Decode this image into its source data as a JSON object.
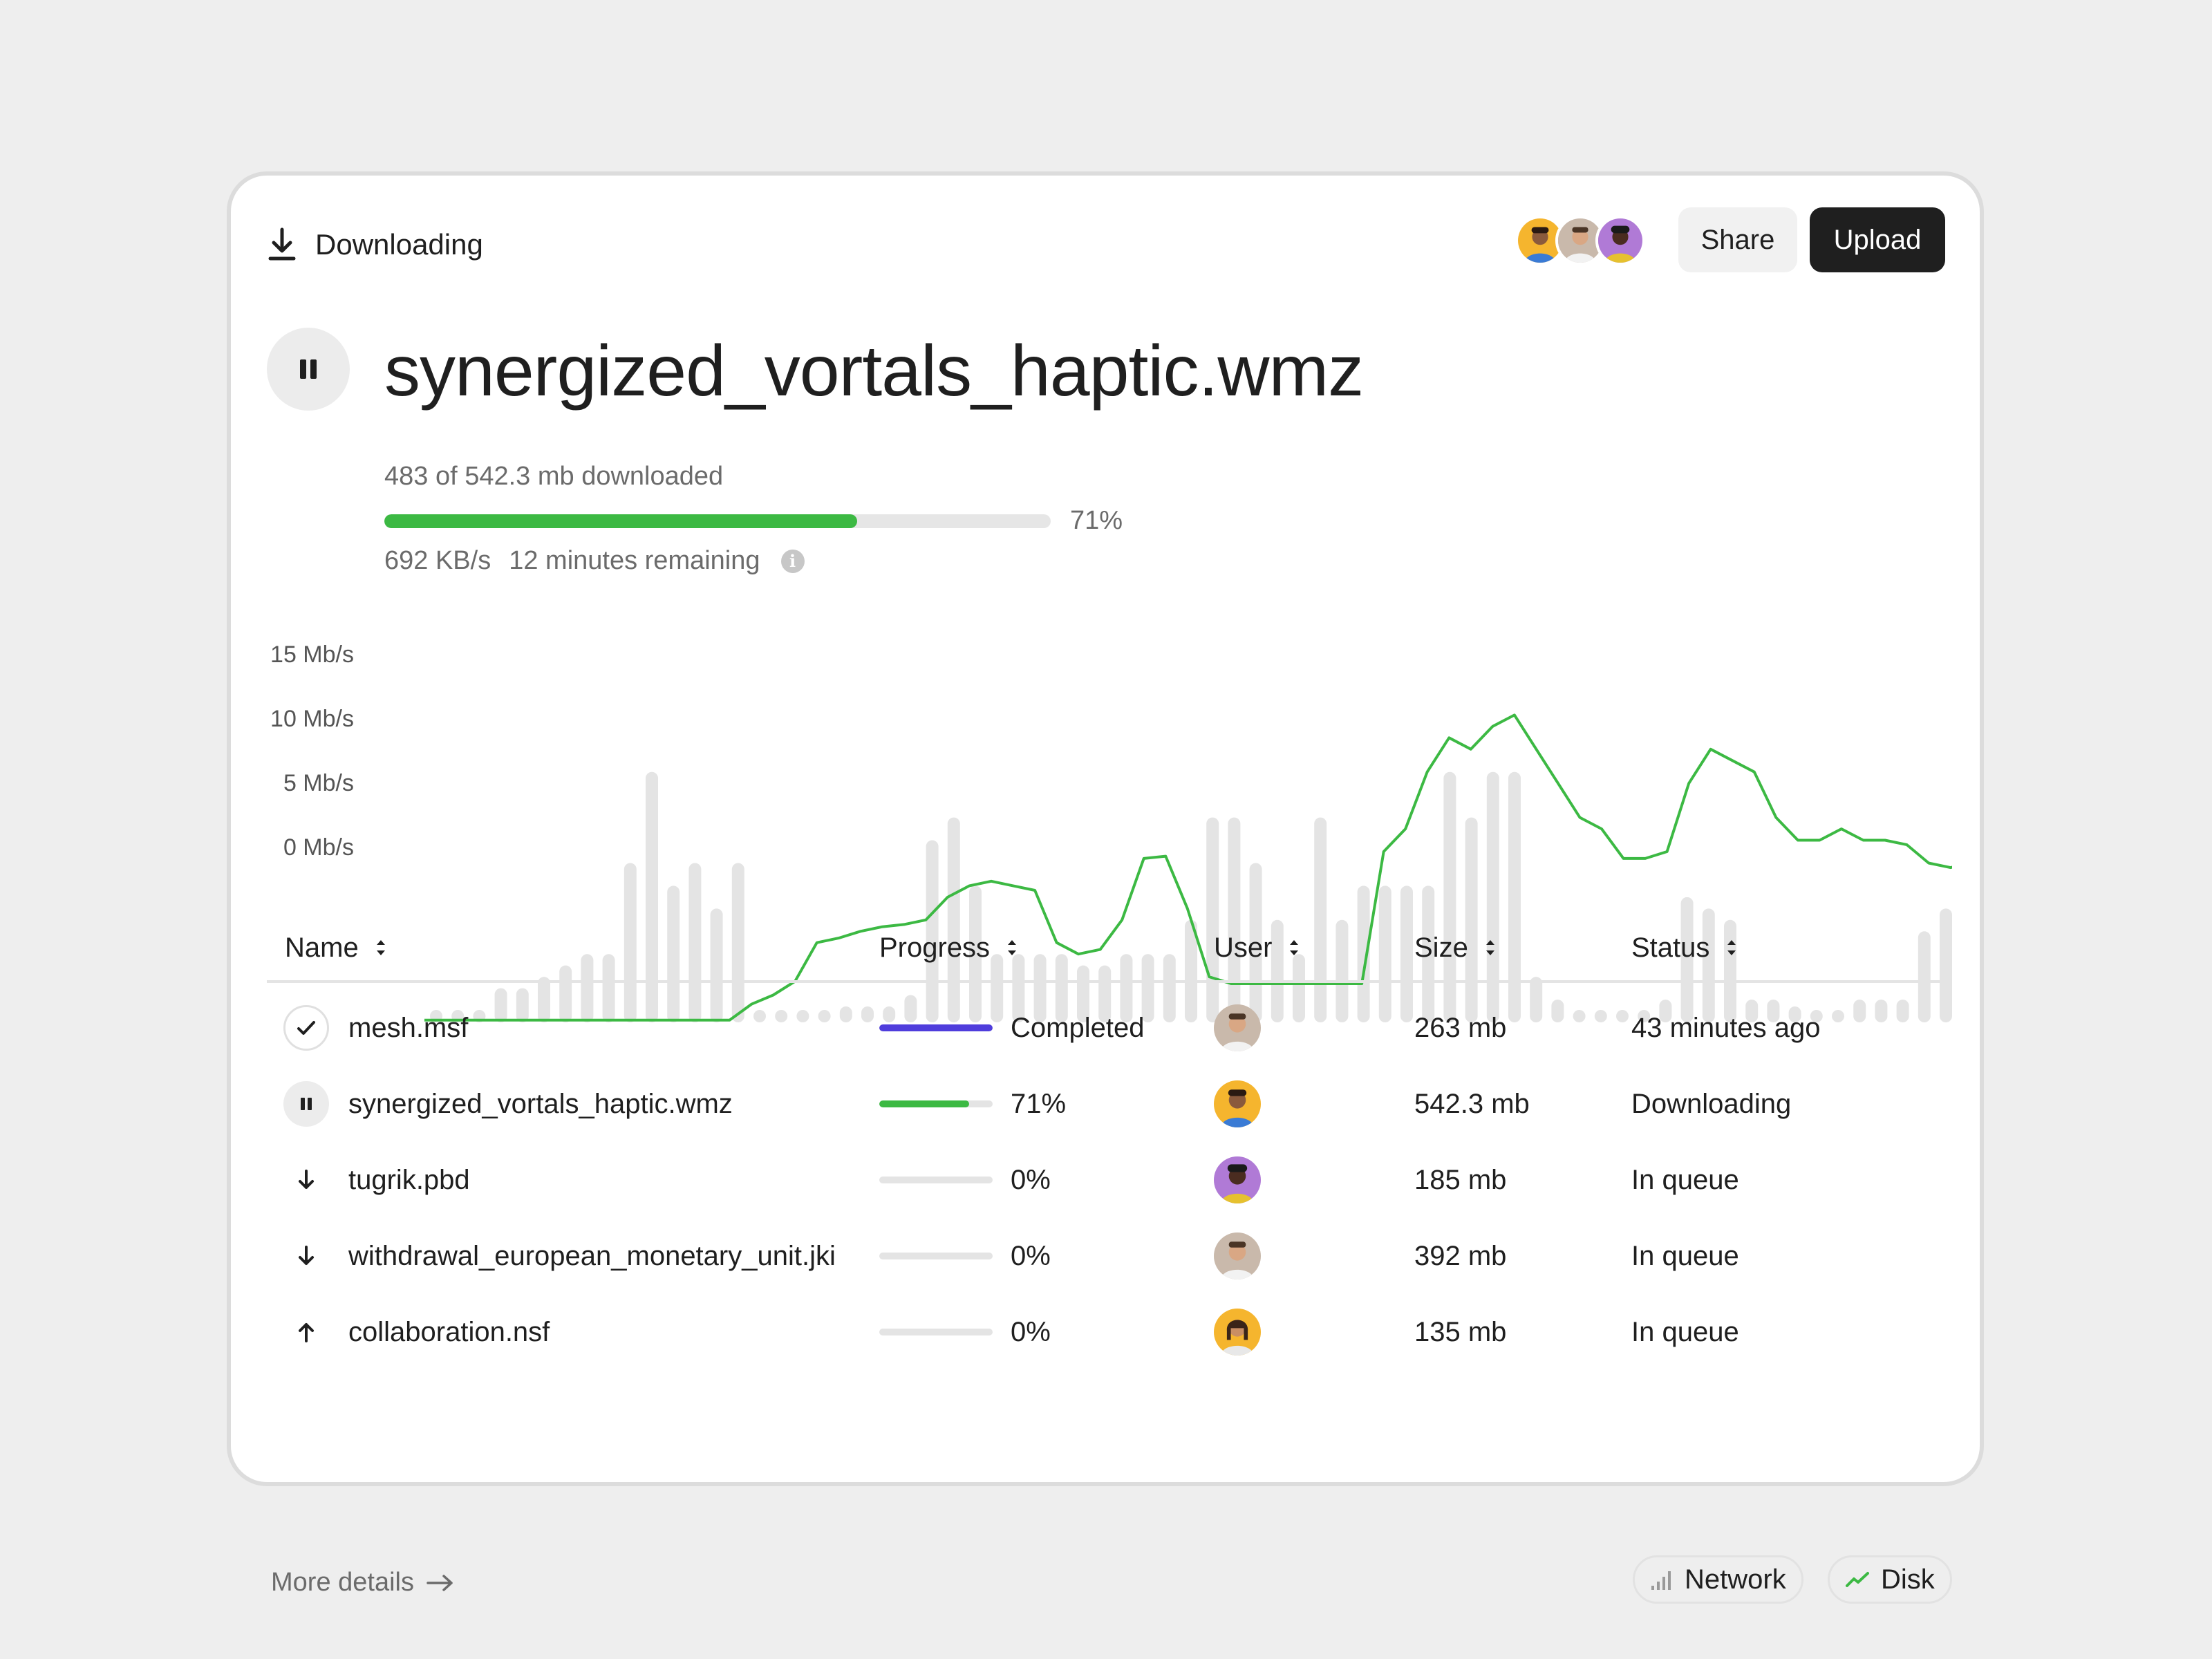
{
  "header": {
    "title": "Downloading",
    "share_label": "Share",
    "upload_label": "Upload"
  },
  "file": {
    "name": "synergized_vortals_haptic.wmz",
    "downloaded_text": "483 of 542.3 mb downloaded",
    "progress_percent": "71%",
    "progress_fraction": 0.71,
    "speed": "692 KB/s",
    "remaining": "12 minutes remaining"
  },
  "chart_data": {
    "type": "bar",
    "y_tick_labels": [
      "15 Mb/s",
      "10 Mb/s",
      "5 Mb/s",
      "0 Mb/s"
    ],
    "ylim": [
      0,
      15
    ],
    "bar_color": "#e4e4e4",
    "line_color": "#3cb943",
    "series": [
      {
        "kind": "bar",
        "values": [
          0.1,
          0.1,
          0.1,
          1.5,
          1.5,
          2.0,
          2.5,
          3.0,
          3.0,
          7.0,
          11.0,
          6.0,
          7.0,
          5.0,
          7.0,
          0.5,
          0.5,
          0.3,
          0.3,
          0.7,
          0.7,
          0.7,
          1.2,
          8.0,
          9.0,
          6.0,
          3.0,
          3.0,
          3.0,
          3.0,
          2.5,
          2.5,
          3.0,
          3.0,
          3.0,
          4.5,
          9.0,
          9.0,
          7.0,
          4.5,
          3.0,
          9.0,
          4.5,
          6.0,
          6.0,
          6.0,
          6.0,
          11.0,
          9.0,
          11.0,
          11.0,
          2.0,
          1.0,
          0.1,
          0.1,
          0.5,
          0.5,
          1.0,
          5.5,
          5.0,
          4.5,
          1.0,
          1.0,
          0.7,
          0.3,
          0.3,
          1.0,
          1.0,
          1.0,
          4.0,
          5.0,
          5.5,
          6.0,
          7.0,
          6.5,
          11.0,
          4.5,
          1.2
        ]
      },
      {
        "kind": "line",
        "values": [
          0.1,
          0.1,
          0.1,
          0.1,
          0.1,
          0.1,
          0.1,
          0.1,
          0.1,
          0.1,
          0.1,
          0.1,
          0.1,
          0.1,
          0.1,
          0.8,
          1.2,
          1.8,
          3.5,
          3.7,
          4.0,
          4.2,
          4.3,
          4.5,
          5.5,
          6.0,
          6.2,
          6.0,
          5.8,
          3.5,
          3.0,
          3.2,
          4.5,
          7.2,
          7.3,
          5.0,
          2.0,
          1.7,
          1.7,
          1.7,
          1.7,
          1.7,
          1.7,
          1.7,
          7.5,
          8.5,
          11.0,
          12.5,
          12.0,
          13.0,
          13.5,
          12.0,
          10.5,
          9.0,
          8.5,
          7.2,
          7.2,
          7.5,
          10.5,
          12.0,
          11.5,
          11.0,
          9.0,
          8.0,
          8.0,
          8.5,
          8.0,
          8.0,
          7.8,
          7.0,
          6.8,
          7.0,
          7.2,
          8.0,
          9.5,
          10.5,
          12.0,
          12.0
        ]
      }
    ]
  },
  "table": {
    "columns": [
      "Name",
      "Progress",
      "User",
      "Size",
      "Status"
    ],
    "rows": [
      {
        "icon": "check-icon",
        "name": "mesh.msf",
        "progress_label": "Completed",
        "progress": 1.0,
        "bar_color": "#4f3ddc",
        "user_avatar": "avatar-man-beard",
        "size": "263 mb",
        "status": "43 minutes ago"
      },
      {
        "icon": "pause-icon",
        "name": "synergized_vortals_haptic.wmz",
        "progress_label": "71%",
        "progress": 0.79,
        "bar_color": "#3cb943",
        "user_avatar": "avatar-man-yellow",
        "size": "542.3 mb",
        "status": "Downloading"
      },
      {
        "icon": "arrow-down-icon",
        "name": "tugrik.pbd",
        "progress_label": "0%",
        "progress": 0.0,
        "bar_color": "#3cb943",
        "user_avatar": "avatar-man-purple",
        "size": "185 mb",
        "status": "In queue"
      },
      {
        "icon": "arrow-down-icon",
        "name": "withdrawal_european_monetary_unit.jki",
        "progress_label": "0%",
        "progress": 0.0,
        "bar_color": "#3cb943",
        "user_avatar": "avatar-man-beard",
        "size": "392 mb",
        "status": "In queue"
      },
      {
        "icon": "arrow-up-icon",
        "name": "collaboration.nsf",
        "progress_label": "0%",
        "progress": 0.0,
        "bar_color": "#3cb943",
        "user_avatar": "avatar-woman-yellow",
        "size": "135 mb",
        "status": "In queue"
      }
    ]
  },
  "footer": {
    "more_details": "More details",
    "network_label": "Network",
    "disk_label": "Disk"
  },
  "colors": {
    "accent_green": "#3cb943",
    "accent_purple": "#4f3ddc",
    "dark": "#1f1f1f"
  }
}
